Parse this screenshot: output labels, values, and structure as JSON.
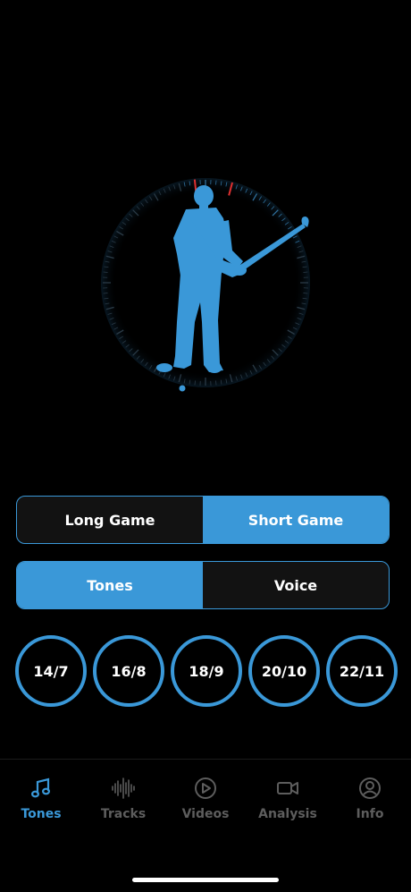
{
  "colors": {
    "accent": "#3a98d8",
    "background": "#000000",
    "segment_inactive": "#121212",
    "tab_inactive": "#5d5d5d",
    "marker": "#e03030"
  },
  "dial": {
    "figure": "golf-swing-silhouette-icon",
    "ring_icon": "tempo-dial-icon"
  },
  "game_selector": {
    "options": [
      "Long Game",
      "Short Game"
    ],
    "selected": "Short Game"
  },
  "mode_selector": {
    "options": [
      "Tones",
      "Voice"
    ],
    "selected": "Tones"
  },
  "ratios": [
    "14/7",
    "16/8",
    "18/9",
    "20/10",
    "22/11"
  ],
  "tabbar": {
    "tabs": [
      {
        "label": "Tones",
        "icon": "music-note-icon"
      },
      {
        "label": "Tracks",
        "icon": "waveform-icon"
      },
      {
        "label": "Videos",
        "icon": "play-circle-icon"
      },
      {
        "label": "Analysis",
        "icon": "video-camera-icon"
      },
      {
        "label": "Info",
        "icon": "profile-icon"
      }
    ],
    "active": "Tones"
  }
}
